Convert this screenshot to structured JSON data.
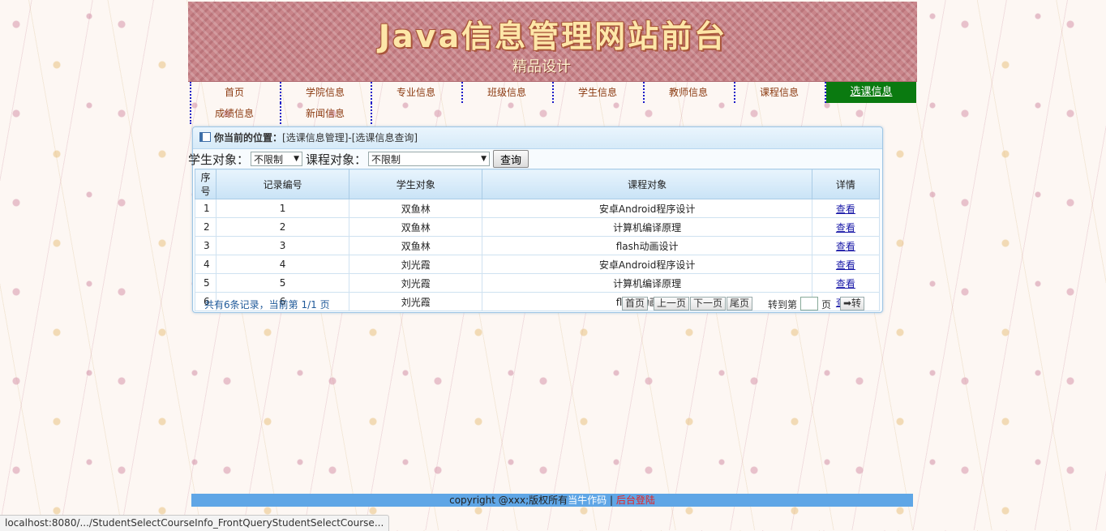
{
  "banner": {
    "title": "Java信息管理网站前台",
    "subtitle": "精品设计"
  },
  "nav": {
    "items": [
      "首页",
      "学院信息",
      "专业信息",
      "班级信息",
      "学生信息",
      "教师信息",
      "课程信息",
      "选课信息",
      "成绩信息",
      "新闻信息"
    ],
    "active": "选课信息"
  },
  "breadcrumb": {
    "prefix": "你当前的位置：",
    "path": "[选课信息管理]-[选课信息查询]"
  },
  "search": {
    "student_label": "学生对象：",
    "student_value": "不限制",
    "course_label": "课程对象：",
    "course_value": "不限制",
    "query_button": "查询"
  },
  "table": {
    "columns": [
      "序号",
      "记录编号",
      "学生对象",
      "课程对象",
      "详情"
    ],
    "rows": [
      [
        "1",
        "1",
        "双鱼林",
        "安卓Android程序设计",
        "查看"
      ],
      [
        "2",
        "2",
        "双鱼林",
        "计算机编译原理",
        "查看"
      ],
      [
        "3",
        "3",
        "双鱼林",
        "flash动画设计",
        "查看"
      ],
      [
        "4",
        "4",
        "刘光霞",
        "安卓Android程序设计",
        "查看"
      ],
      [
        "5",
        "5",
        "刘光霞",
        "计算机编译原理",
        "查看"
      ],
      [
        "6",
        "6",
        "刘光霞",
        "flash动画设计",
        "查看"
      ]
    ]
  },
  "pager": {
    "info": "共有6条记录，当前第 1/1 页",
    "first": "首页",
    "prev": "上一页",
    "next": "下一页",
    "last": "尾页",
    "jump_label": "转到第",
    "jump_unit": "页",
    "go": "➡转"
  },
  "footer": {
    "copyright": "copyright @xxx;版权所有",
    "author": "当牛作码",
    "separator": "|",
    "admin": "后台登陆"
  },
  "statusbar": {
    "url": "localhost:8080/.../StudentSelectCourseInfo_FrontQueryStudentSelectCourse..."
  }
}
